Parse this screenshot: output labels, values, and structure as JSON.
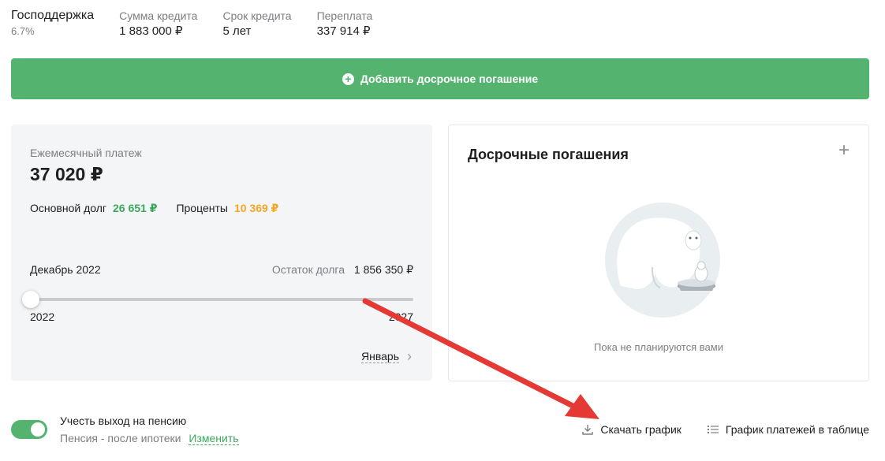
{
  "summary": {
    "program": {
      "label": "Господдержка",
      "value": "6.7%"
    },
    "amount": {
      "label": "Сумма кредита",
      "value": "1 883 000 ₽"
    },
    "term": {
      "label": "Срок кредита",
      "value": "5 лет"
    },
    "overpay": {
      "label": "Переплата",
      "value": "337 914 ₽"
    }
  },
  "add_button": {
    "label": "Добавить досрочное погашение"
  },
  "payment": {
    "monthly_label": "Ежемесячный платеж",
    "monthly_value": "37 020 ₽",
    "principal_label": "Основной долг",
    "principal_value": "26 651 ₽",
    "interest_label": "Проценты",
    "interest_value": "10 369 ₽",
    "month": "Декабрь 2022",
    "remaining_label": "Остаток долга",
    "remaining_value": "1 856 350 ₽",
    "year_start": "2022",
    "year_end": "2027",
    "slider_position": 0.0,
    "next_label": "Январь"
  },
  "early": {
    "title": "Досрочные погашения",
    "empty_text": "Пока не планируются вами"
  },
  "pension": {
    "toggle_on": true,
    "label": "Учесть выход на пенсию",
    "sub_label": "Пенсия - после ипотеки",
    "change_link": "Изменить"
  },
  "actions": {
    "download": "Скачать график",
    "table": "График платежей в таблице"
  },
  "colors": {
    "accent": "#54b36e",
    "principal": "#3aa95b",
    "interest": "#f5a623",
    "annotation_arrow": "#e53935"
  }
}
